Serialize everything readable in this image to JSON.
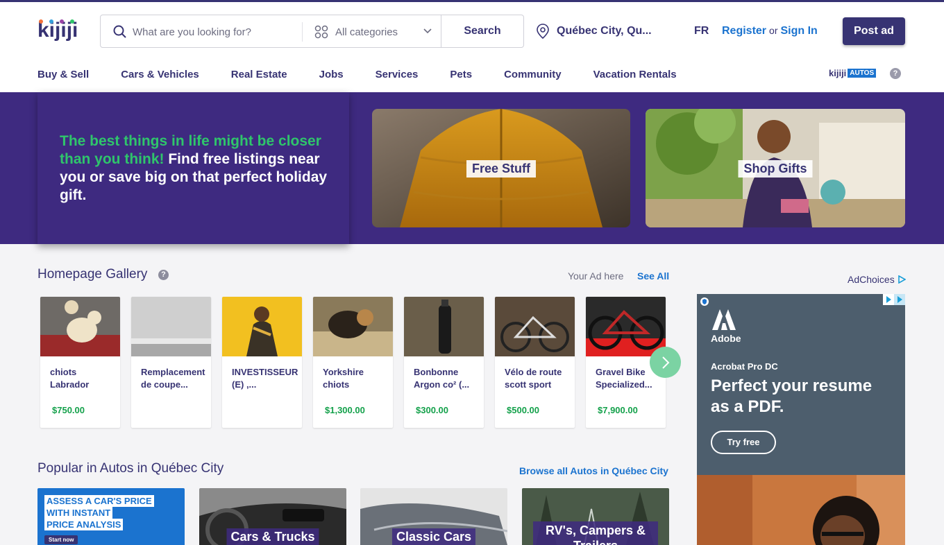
{
  "header": {
    "logo_text": "kijiji",
    "search_placeholder": "What are you looking for?",
    "category_label": "All categories",
    "search_button": "Search",
    "location": "Québec City, Qu...",
    "language": "FR",
    "register": "Register",
    "or": "or",
    "sign_in": "Sign In",
    "post_ad": "Post ad"
  },
  "nav": {
    "items": [
      {
        "label": "Buy & Sell"
      },
      {
        "label": "Cars & Vehicles"
      },
      {
        "label": "Real Estate"
      },
      {
        "label": "Jobs"
      },
      {
        "label": "Services"
      },
      {
        "label": "Pets"
      },
      {
        "label": "Community"
      },
      {
        "label": "Vacation Rentals"
      }
    ],
    "autos_logo_kijiji": "kijiji",
    "autos_logo_autos": "AUTOS",
    "help": "?"
  },
  "hero": {
    "headline_green": "The best things in life might be closer than you think!",
    "headline_white": "Find free listings near you or save big on that perfect holiday gift.",
    "cards": [
      {
        "label": "Free Stuff"
      },
      {
        "label": "Shop Gifts"
      }
    ]
  },
  "gallery": {
    "title": "Homepage Gallery",
    "help": "?",
    "your_ad": "Your Ad here",
    "see_all": "See All",
    "items": [
      {
        "title": "chiots Labrador",
        "price": "$750.00"
      },
      {
        "title": "Remplacement de coupe...",
        "price": ""
      },
      {
        "title": "INVESTISSEUR (E) ,...",
        "price": ""
      },
      {
        "title": "Yorkshire chiots",
        "price": "$1,300.00"
      },
      {
        "title": "Bonbonne Argon co² (...",
        "price": "$300.00"
      },
      {
        "title": "Vélo de route scott sport",
        "price": "$500.00"
      },
      {
        "title": "Gravel Bike Specialized...",
        "price": "$7,900.00"
      }
    ]
  },
  "ad": {
    "adchoices": "AdChoices",
    "brand": "Adobe",
    "product": "Acrobat Pro DC",
    "headline": "Perfect your resume as a PDF.",
    "cta": "Try free"
  },
  "autos": {
    "title": "Popular in Autos in Québec City",
    "browse_all": "Browse all Autos in Québec City",
    "promo_line1": "ASSESS A CAR'S PRICE",
    "promo_line2": "WITH INSTANT",
    "promo_line3": "PRICE ANALYSIS",
    "promo_button": "Start now",
    "cards": [
      {
        "label": "Cars & Trucks"
      },
      {
        "label": "Classic Cars"
      },
      {
        "label": "RV's, Campers & Trailers"
      }
    ]
  },
  "colors": {
    "brand": "#373373",
    "hero_bg": "#3e2a80",
    "link": "#1b73cf",
    "green": "#2fc56b",
    "price": "#14a14b"
  }
}
